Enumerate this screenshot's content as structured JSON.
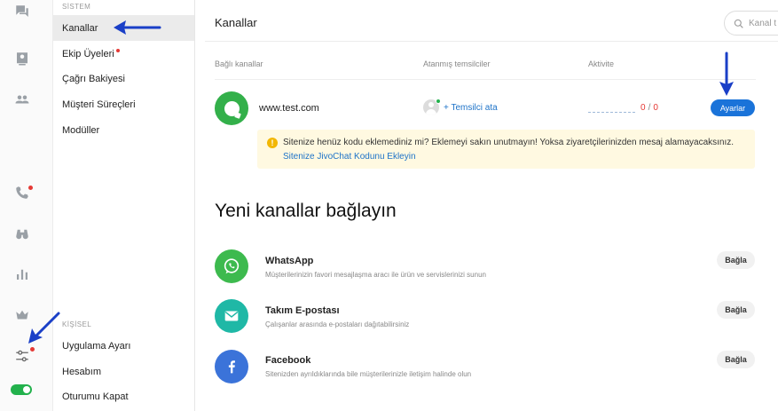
{
  "menu": {
    "system_section": "SİSTEM",
    "personal_section": "KİŞİSEL",
    "items": [
      {
        "label": "Kanallar"
      },
      {
        "label": "Ekip Üyeleri"
      },
      {
        "label": "Çağrı Bakiyesi"
      },
      {
        "label": "Müşteri Süreçleri"
      },
      {
        "label": "Modüller"
      }
    ],
    "personal_items": [
      {
        "label": "Uygulama Ayarı"
      },
      {
        "label": "Hesabım"
      },
      {
        "label": "Oturumu Kapat"
      }
    ]
  },
  "header": {
    "title": "Kanallar",
    "search_placeholder": "Kanal t"
  },
  "connected": {
    "col_channels": "Bağlı kanallar",
    "col_agents": "Atanmış temsilciler",
    "col_activity": "Aktivite",
    "channel_name": "www.test.com",
    "assign_label": "+ Temsilci ata",
    "activity_left": "0",
    "activity_sep": "/",
    "activity_right": "0",
    "settings_label": "Ayarlar",
    "warning_text": "Sitenize henüz kodu eklemediniz mi? Eklemeyi sakın unutmayın! Yoksa ziyaretçilerinizden mesaj alamayacaksınız.",
    "warning_link": "Sitenize JivoChat Kodunu Ekleyin"
  },
  "new_channels": {
    "title": "Yeni kanallar bağlayın",
    "connect_label": "Bağla",
    "items": [
      {
        "name": "WhatsApp",
        "desc": "Müşterilerinizin favori mesajlaşma aracı ile ürün ve servislerinizi sunun",
        "color": "#3dba4e",
        "icon": "whatsapp-icon"
      },
      {
        "name": "Takım E-postası",
        "desc": "Çalışanlar arasında e-postaları dağıtabilirsiniz",
        "color": "#1fb8a6",
        "icon": "envelope-icon"
      },
      {
        "name": "Facebook",
        "desc": "Sitenizden ayrıldıklarında bile müşterilerinizle iletişim halinde olun",
        "color": "#3b73d9",
        "icon": "facebook-icon"
      }
    ]
  },
  "colors": {
    "accent": "#1a73d9",
    "annotation_arrow": "#1a3fc7",
    "notification_dot": "#e53935",
    "online": "#22b14c"
  }
}
